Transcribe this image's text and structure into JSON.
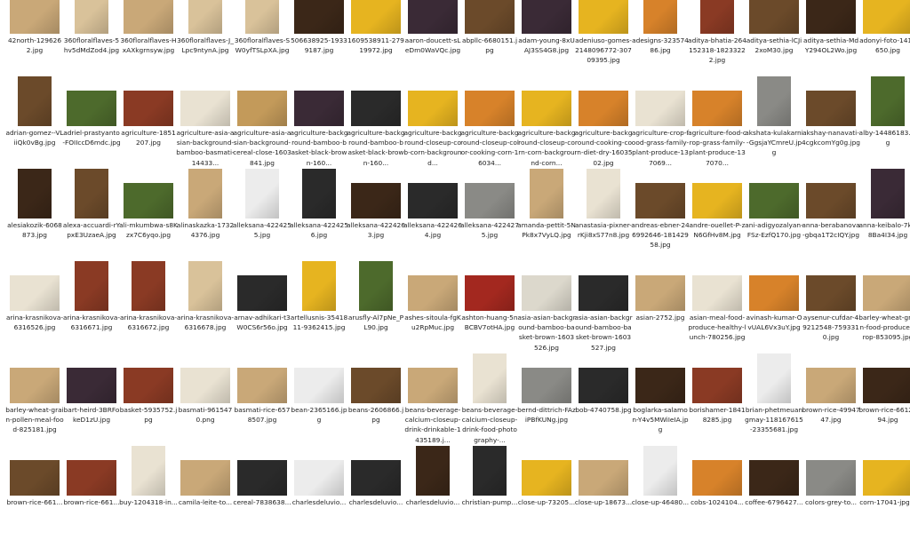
{
  "colors": {
    "beige": "#c9a878",
    "beige_light": "#d9c29a",
    "wheat": "#c39a5a",
    "dark_purple": "#3a2a36",
    "brown": "#6b4a2a",
    "dark_brown": "#3b2718",
    "corn_yellow": "#e6b420",
    "orange": "#d7822a",
    "red_brown": "#8a3a24",
    "red": "#a3281f",
    "cream": "#e9e2d2",
    "white_bg": "#ececec",
    "dark": "#2a2a2a",
    "grey": "#8a8a86",
    "green": "#4d6a2c",
    "rice_white": "#dcd8cc"
  },
  "files": [
    {
      "name": "42north-1296262.jpg",
      "color": "beige",
      "shape": "landscape"
    },
    {
      "name": "360floralflaves-5hv5dMdZod4.jpg",
      "color": "beige_light",
      "shape": "portrait"
    },
    {
      "name": "360floralflaves-HxAXkgrnsyw.jpg",
      "color": "beige",
      "shape": "landscape"
    },
    {
      "name": "360floralflaves-J_Lpc9ntynA.jpg",
      "color": "beige_light",
      "shape": "portrait"
    },
    {
      "name": "360floralflaves-SW0yfTSLpXA.jpg",
      "color": "beige_light",
      "shape": "portrait"
    },
    {
      "name": "506638925-19339187.jpg",
      "color": "dark_brown",
      "shape": "landscape"
    },
    {
      "name": "1609538911-27919972.jpg",
      "color": "corn_yellow",
      "shape": "landscape"
    },
    {
      "name": "aaron-doucett-sLeDm0WaVQc.jpg",
      "color": "dark_purple",
      "shape": "landscape"
    },
    {
      "name": "abpllc-6680151.jpg",
      "color": "brown",
      "shape": "landscape"
    },
    {
      "name": "adam-young-8xUAJ3SS4G8.jpg",
      "color": "dark_purple",
      "shape": "landscape"
    },
    {
      "name": "adeniuso-gomes-2148096772-30709395.jpg",
      "color": "corn_yellow",
      "shape": "landscape"
    },
    {
      "name": "adesigns-32357486.jpg",
      "color": "orange",
      "shape": "portrait"
    },
    {
      "name": "aditya-bhatia-264152318-18233222.jpg",
      "color": "red_brown",
      "shape": "portrait"
    },
    {
      "name": "aditya-sethia-lCJi2xoM30.jpg",
      "color": "brown",
      "shape": "landscape"
    },
    {
      "name": "aditya-sethia-MdY294OL2Wo.jpg",
      "color": "dark_brown",
      "shape": "landscape"
    },
    {
      "name": "adonyi-foto-1414650.jpg",
      "color": "corn_yellow",
      "shape": "landscape"
    },
    {
      "name": "adrian-gomez--VLiiQk0vBg.jpg",
      "color": "brown",
      "shape": "portrait"
    },
    {
      "name": "adriel-prastyanto-FOIIccD6mdc.jpg",
      "color": "green",
      "shape": "landscape"
    },
    {
      "name": "agriculture-1851207.jpg",
      "color": "red_brown",
      "shape": "landscape"
    },
    {
      "name": "agriculture-asia-asian-background-bamboo-basmati-14433...",
      "color": "cream",
      "shape": "landscape"
    },
    {
      "name": "agriculture-asia-asian-background-cereal-close-1603841.jpg",
      "color": "wheat",
      "shape": "landscape"
    },
    {
      "name": "agriculture-background-bamboo-basket-black-brown-160...",
      "color": "dark_purple",
      "shape": "landscape"
    },
    {
      "name": "agriculture-background-bamboo-basket-black-brown-160...",
      "color": "dark",
      "shape": "landscape"
    },
    {
      "name": "agriculture-background-closeup-cob-corn-background...",
      "color": "corn_yellow",
      "shape": "landscape"
    },
    {
      "name": "agriculture-background-closeup-color-cooking-corn-16034...",
      "color": "orange",
      "shape": "landscape"
    },
    {
      "name": "agriculture-background-closeup-corn-corn-background-corn...",
      "color": "corn_yellow",
      "shape": "landscape"
    },
    {
      "name": "agriculture-background-cooking-corn-diet-dry-1603502.jpg",
      "color": "orange",
      "shape": "landscape"
    },
    {
      "name": "agriculture-crop-food-grass-family-plant-produce-137069...",
      "color": "cream",
      "shape": "landscape"
    },
    {
      "name": "agriculture-food-crop-grass-family-plant-produce-137070...",
      "color": "orange",
      "shape": "landscape"
    },
    {
      "name": "akshata-kulakarni-GgsjaYCmreU.jpg",
      "color": "grey",
      "shape": "portrait"
    },
    {
      "name": "akshay-nanavati-4cgkcomYg0g.jpg",
      "color": "brown",
      "shape": "landscape"
    },
    {
      "name": "alby-14486183.jpg",
      "color": "green",
      "shape": "portrait"
    },
    {
      "name": "alesiakozik-6068873.jpg",
      "color": "dark_brown",
      "shape": "portrait"
    },
    {
      "name": "alexa-accuardi-rYpxE3UzaeA.jpg",
      "color": "brown",
      "shape": "portrait"
    },
    {
      "name": "ali-mkumbwa-s8Kzx7C6yqo.jpg",
      "color": "green",
      "shape": "landscape"
    },
    {
      "name": "alinaskazka-17324376.jpg",
      "color": "beige",
      "shape": "portrait"
    },
    {
      "name": "alleksana-4224255.jpg",
      "color": "white_bg",
      "shape": "portrait"
    },
    {
      "name": "alleksana-4224256.jpg",
      "color": "dark",
      "shape": "portrait"
    },
    {
      "name": "alleksana-4224263.jpg",
      "color": "dark_brown",
      "shape": "landscape"
    },
    {
      "name": "alleksana-4224264.jpg",
      "color": "dark",
      "shape": "landscape"
    },
    {
      "name": "alleksana-4224275.jpg",
      "color": "grey",
      "shape": "landscape"
    },
    {
      "name": "amanda-pettit-5NPk8x7VyLQ.jpg",
      "color": "beige",
      "shape": "portrait"
    },
    {
      "name": "anastasia-pixner-rKji8xS77n8.jpg",
      "color": "cream",
      "shape": "portrait"
    },
    {
      "name": "andreas-ebner-246992646-18142958.jpg",
      "color": "brown",
      "shape": "landscape"
    },
    {
      "name": "andre-ouellet-P-zN6GfHv8M.jpg",
      "color": "corn_yellow",
      "shape": "landscape"
    },
    {
      "name": "ani-adigyozalyan-FSz-EzfQ170.jpg",
      "color": "green",
      "shape": "landscape"
    },
    {
      "name": "anna-berabanova-gbqa1T2cIQY.jpg",
      "color": "brown",
      "shape": "landscape"
    },
    {
      "name": "anna-keibalo-7k-r8Ba4I34.jpg",
      "color": "dark_purple",
      "shape": "portrait"
    },
    {
      "name": "arina-krasnikova-6316526.jpg",
      "color": "cream",
      "shape": "landscape"
    },
    {
      "name": "arina-krasnikova-6316671.jpg",
      "color": "red_brown",
      "shape": "portrait"
    },
    {
      "name": "arina-krasnikova-6316672.jpg",
      "color": "red_brown",
      "shape": "portrait"
    },
    {
      "name": "arina-krasnikova-6316678.jpg",
      "color": "beige_light",
      "shape": "portrait"
    },
    {
      "name": "arnav-adhikari-t3W0CS6r56o.jpg",
      "color": "dark",
      "shape": "landscape"
    },
    {
      "name": "artellusnis-3541811-9362415.jpg",
      "color": "corn_yellow",
      "shape": "portrait"
    },
    {
      "name": "arusfly-Al7pNe_PL90.jpg",
      "color": "green",
      "shape": "portrait"
    },
    {
      "name": "ashes-sitoula-fgKu2RpMuc.jpg",
      "color": "beige",
      "shape": "landscape"
    },
    {
      "name": "ashton-huang-5nBCBV7otHA.jpg",
      "color": "red",
      "shape": "landscape"
    },
    {
      "name": "asia-asian-background-bamboo-basket-brown-1603526.jpg",
      "color": "rice_white",
      "shape": "landscape"
    },
    {
      "name": "asia-asian-background-bamboo-basket-brown-1603527.jpg",
      "color": "dark",
      "shape": "landscape"
    },
    {
      "name": "asian-2752.jpg",
      "color": "beige",
      "shape": "landscape"
    },
    {
      "name": "asian-meal-food-produce-healthy-lunch-780256.jpg",
      "color": "cream",
      "shape": "landscape"
    },
    {
      "name": "avinash-kumar-OvUAL6Vx3uY.jpg",
      "color": "orange",
      "shape": "landscape"
    },
    {
      "name": "aysenur-cufdar-49212548-7593310.jpg",
      "color": "brown",
      "shape": "landscape"
    },
    {
      "name": "barley-wheat-grain-food-produce-crop-853095.jpg",
      "color": "beige",
      "shape": "landscape"
    },
    {
      "name": "barley-wheat-grain-pollen-meal-food-825181.jpg",
      "color": "beige",
      "shape": "landscape"
    },
    {
      "name": "bart-heird-3BRFokeD1zU.jpg",
      "color": "dark_purple",
      "shape": "landscape"
    },
    {
      "name": "basket-5935752.jpg",
      "color": "red_brown",
      "shape": "landscape"
    },
    {
      "name": "basmati-9615470.png",
      "color": "cream",
      "shape": "landscape"
    },
    {
      "name": "basmati-rice-6578507.jpg",
      "color": "beige",
      "shape": "landscape"
    },
    {
      "name": "bean-2365166.jpg",
      "color": "white_bg",
      "shape": "landscape"
    },
    {
      "name": "beans-2606866.jpg",
      "color": "brown",
      "shape": "landscape"
    },
    {
      "name": "beans-beverage-calcium-closeup-drink-drinkable-1435189.j...",
      "color": "beige",
      "shape": "landscape"
    },
    {
      "name": "beans-beverage-calcium-closeup-drink-food-photography-...",
      "color": "cream",
      "shape": "portrait"
    },
    {
      "name": "bernd-dittrich-FAziPBfKUNg.jpg",
      "color": "grey",
      "shape": "landscape"
    },
    {
      "name": "bob-4740758.jpg",
      "color": "dark",
      "shape": "landscape"
    },
    {
      "name": "boglarka-salamon-Y4v5MWiIeIA.jpg",
      "color": "dark_brown",
      "shape": "landscape"
    },
    {
      "name": "borishamer-18418285.jpg",
      "color": "red_brown",
      "shape": "landscape"
    },
    {
      "name": "brian-phetmeuangmay-118167615-23355681.jpg",
      "color": "white_bg",
      "shape": "portrait"
    },
    {
      "name": "brown-rice-4994747.jpg",
      "color": "beige",
      "shape": "landscape"
    },
    {
      "name": "brown-rice-6612194.jpg",
      "color": "dark_brown",
      "shape": "landscape"
    },
    {
      "name": "brown-rice-661...",
      "color": "brown",
      "shape": "landscape"
    },
    {
      "name": "brown-rice-661...",
      "color": "red_brown",
      "shape": "landscape"
    },
    {
      "name": "buy-1204318-in...",
      "color": "cream",
      "shape": "portrait"
    },
    {
      "name": "camila-leite-to...",
      "color": "beige",
      "shape": "landscape"
    },
    {
      "name": "cereal-7838638...",
      "color": "dark",
      "shape": "landscape"
    },
    {
      "name": "charlesdeluvio...",
      "color": "white_bg",
      "shape": "landscape"
    },
    {
      "name": "charlesdeluvio...",
      "color": "dark",
      "shape": "landscape"
    },
    {
      "name": "charlesdeluvio...",
      "color": "dark_brown",
      "shape": "portrait"
    },
    {
      "name": "christian-pump...",
      "color": "dark",
      "shape": "portrait"
    },
    {
      "name": "close-up-73205...",
      "color": "corn_yellow",
      "shape": "landscape"
    },
    {
      "name": "close-up-18673...",
      "color": "beige",
      "shape": "landscape"
    },
    {
      "name": "close-up-46480...",
      "color": "white_bg",
      "shape": "portrait"
    },
    {
      "name": "cobs-1024104...",
      "color": "orange",
      "shape": "landscape"
    },
    {
      "name": "coffee-6796427...",
      "color": "dark_brown",
      "shape": "landscape"
    },
    {
      "name": "colors-grey-to...",
      "color": "grey",
      "shape": "landscape"
    },
    {
      "name": "corn-17041-jpg...",
      "color": "corn_yellow",
      "shape": "landscape"
    }
  ]
}
